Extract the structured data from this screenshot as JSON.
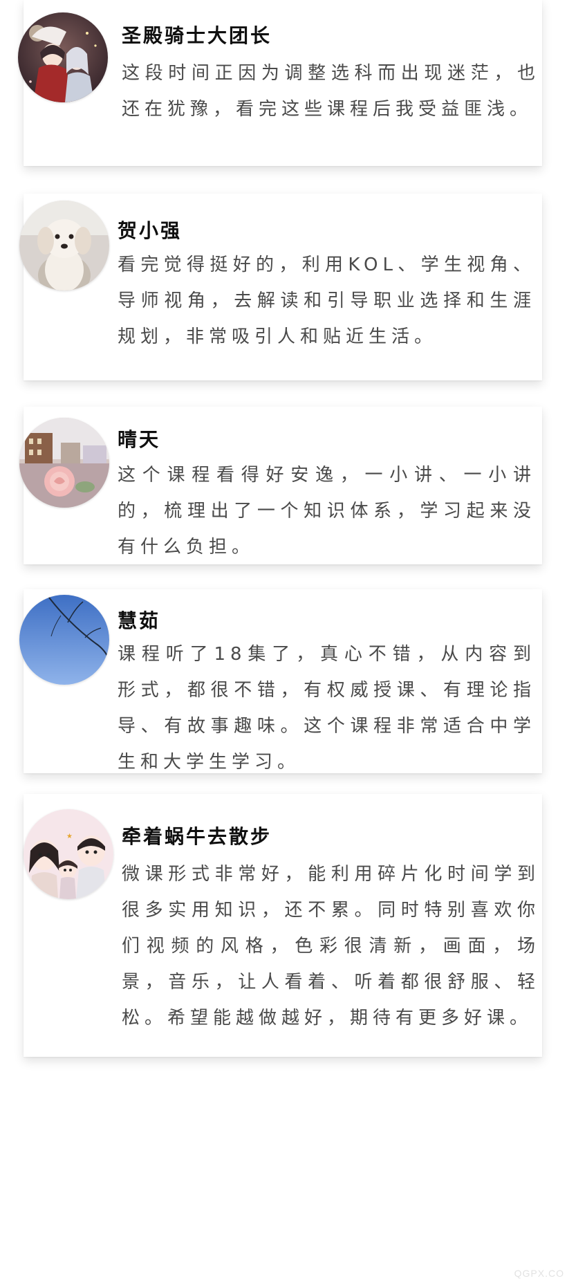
{
  "reviews": [
    {
      "name": "圣殿骑士大团长",
      "avatar_icon": "anime-girls-avatar-icon",
      "comment": "这段时间正因为调整选科而出现迷茫，也还在犹豫，看完这些课程后我受益匪浅。"
    },
    {
      "name": "贺小强",
      "avatar_icon": "white-dog-avatar-icon",
      "comment": "看完觉得挺好的，利用KOL、学生视角、导师视角，去解读和引导职业选择和生涯规划，非常吸引人和贴近生活。"
    },
    {
      "name": "晴天",
      "avatar_icon": "rose-town-avatar-icon",
      "comment": "这个课程看得好安逸，一小讲、一小讲的，梳理出了一个知识体系，学习起来没有什么负担。"
    },
    {
      "name": "慧茹",
      "avatar_icon": "blue-sky-branches-avatar-icon",
      "comment": "课程听了18集了，真心不错，从内容到形式，都很不错，有权威授课、有理论指导、有故事趣味。这个课程非常适合中学生和大学生学习。"
    },
    {
      "name": "牵着蜗牛去散步",
      "avatar_icon": "cartoon-family-avatar-icon",
      "comment": "微课形式非常好，能利用碎片化时间学到很多实用知识，还不累。同时特别喜欢你们视频的风格，色彩很清新，画面，场景，音乐，让人看着、听着都很舒服、轻松。希望能越做越好，期待有更多好课。"
    }
  ],
  "watermark": "QGPX.CO"
}
